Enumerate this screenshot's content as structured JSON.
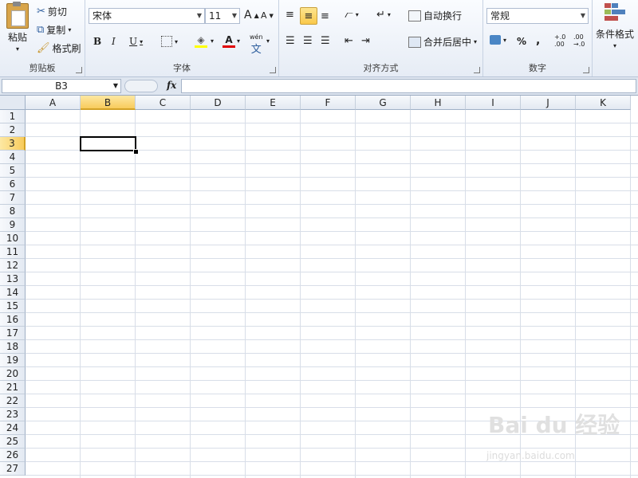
{
  "clipboard": {
    "paste": "粘贴",
    "cut": "剪切",
    "copy": "复制",
    "format_painter": "格式刷",
    "group_label": "剪贴板"
  },
  "font": {
    "name": "宋体",
    "size": "11",
    "grow": "A",
    "shrink": "A",
    "bold": "B",
    "italic": "I",
    "underline": "U",
    "fill_color_glyph": "◈",
    "font_color_glyph": "A",
    "phonetic_glyph": "wén",
    "phonetic_char": "文",
    "group_label": "字体"
  },
  "alignment": {
    "wrap_text": "自动换行",
    "merge_center": "合并后居中",
    "group_label": "对齐方式"
  },
  "number": {
    "format": "常规",
    "percent": "%",
    "comma": ",",
    "increase_decimal": "+.0\n.00",
    "decrease_decimal": ".00\n→.0",
    "group_label": "数字"
  },
  "styles": {
    "conditional_formatting": "条件格式"
  },
  "formula_bar": {
    "name_box": "B3",
    "fx": "fx",
    "value": ""
  },
  "sheet": {
    "columns": [
      "A",
      "B",
      "C",
      "D",
      "E",
      "F",
      "G",
      "H",
      "I",
      "J",
      "K"
    ],
    "rows": [
      "1",
      "2",
      "3",
      "4",
      "5",
      "6",
      "7",
      "8",
      "9",
      "10",
      "11",
      "12",
      "13",
      "14",
      "15",
      "16",
      "17",
      "18",
      "19",
      "20",
      "21",
      "22",
      "23",
      "24",
      "25",
      "26",
      "27"
    ],
    "selected_column": "B",
    "selected_row": "3"
  },
  "watermark": {
    "brand": "Bai du 经验",
    "url": "jingyan.baidu.com"
  },
  "colors": {
    "selection_header": "#f8cb5c",
    "grid_line": "#d8dee8",
    "ribbon_bg": "#e6ecf5"
  }
}
